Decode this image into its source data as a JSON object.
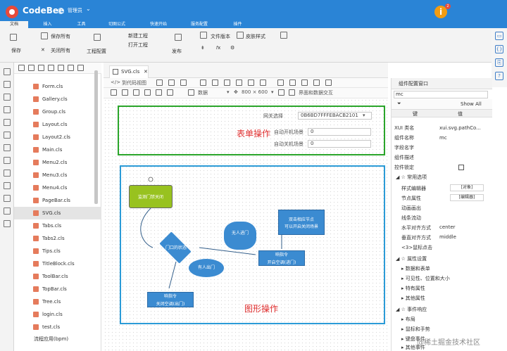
{
  "app": {
    "name": "CodeBee",
    "user": "管理员"
  },
  "menu": {
    "tabs": [
      "文档",
      "插入",
      "工具",
      "切图公式",
      "快速开始",
      "服务配置",
      "插件"
    ]
  },
  "ribbon": {
    "save": "保存",
    "saveAll": "保存所有",
    "closeAll": "关闭所有",
    "projectConfig": "工程配置",
    "newProject": "新建工程",
    "openProject": "打开工程",
    "publish": "发布",
    "fileVersion": "文件版本",
    "skin": "皮肤样式"
  },
  "notifications": {
    "count": "2"
  },
  "fileTree": {
    "files": [
      "Form.cls",
      "Gallery.cls",
      "Group.cls",
      "Layout.cls",
      "Layout2.cls",
      "Main.cls",
      "Menu2.cls",
      "Menu3.cls",
      "Menu4.cls",
      "PageBar.cls",
      "SVG.cls",
      "Tabs.cls",
      "Tabs2.cls",
      "Tips.cls",
      "TitleBlock.cls",
      "ToolBar.cls",
      "TopBar.cls",
      "Tree.cls",
      "login.cls",
      "test.cls"
    ],
    "folder": "流程应用(bpm)"
  },
  "editor": {
    "tab": "SVG.cls",
    "toolbar1": {
      "toCode": "到代码视图"
    },
    "toolbar2": {
      "data": "数据",
      "size": "800 × 600",
      "interact": "界面和数据交互"
    }
  },
  "form": {
    "title": "表单操作",
    "fields": [
      {
        "label": "网关选择",
        "value": "0B6BD7FFFEBACB2101"
      },
      {
        "label": "自动开机场景",
        "value": "0"
      },
      {
        "label": "自动关机场景",
        "value": "0"
      }
    ]
  },
  "graph": {
    "title": "图形操作",
    "startNode": "监测门禁关闭",
    "decision": "门口的状态",
    "process1": "响指令\n开启空调(进门)",
    "process2": "响指令\n关闭空调(出门)",
    "bubble1": "有人出门",
    "bubble2": "无人进门",
    "callout": "双击相应节点\n可以开启关闭场景"
  },
  "panel": {
    "title": "组件配置窗口",
    "search": "mc",
    "showAll": "Show All",
    "columns": [
      "键",
      "值"
    ],
    "rows": [
      {
        "k": "XUI 类名",
        "v": "xui.svg.pathCo..."
      },
      {
        "k": "组件名称",
        "v": "mc"
      },
      {
        "k": "字段名字",
        "v": ""
      },
      {
        "k": "组件描述",
        "v": ""
      },
      {
        "k": "控件锁定",
        "v": ""
      }
    ],
    "sections": {
      "common": "常用选项",
      "styleEditor": "样式编辑器",
      "nodeProps": "节点属性",
      "animation": "动画画出",
      "lineFlow": "线条流动",
      "hAlign": "水平对齐方式",
      "vAlign": "垂直对齐方式",
      "mouseClick": "<3>鼠标点击",
      "attrSettings": "属性设置",
      "dataForm": "数据和表单",
      "visibility": "可见性、位置和大小",
      "special": "特有属性",
      "other": "其他属性",
      "events": "事件响应",
      "layout": "布局",
      "mouseHand": "鼠标和手势",
      "keyboard": "键盘事件",
      "otherEvents": "其他事件"
    },
    "values": {
      "styleBtn": "[对象]",
      "nodeBtn": "[编辑器]",
      "hAlign": "center",
      "vAlign": "middle"
    }
  },
  "watermark": "@稀土掘金技术社区"
}
